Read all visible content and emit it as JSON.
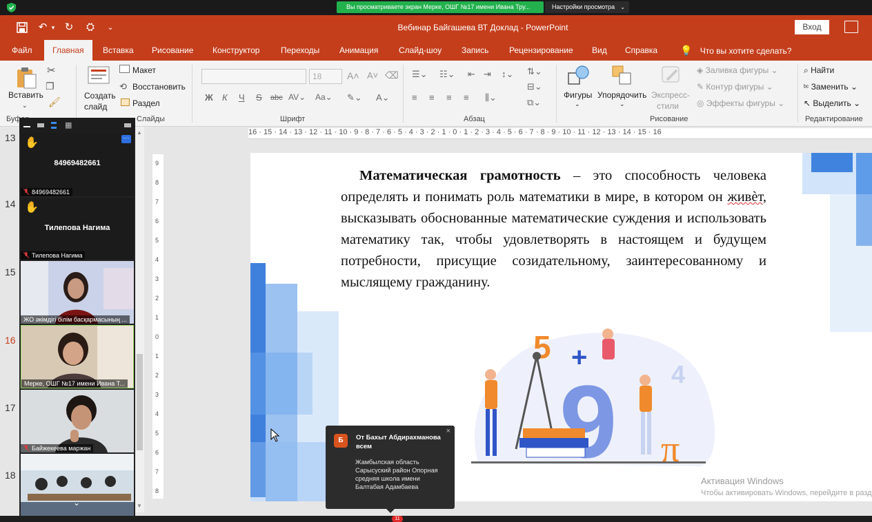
{
  "zoom": {
    "share_banner": "Вы просматриваете экран Мерке, ОШГ №17 имени Ивана Тру...",
    "view_options": "Настройки просмотра"
  },
  "powerpoint": {
    "title": "Вебинар Байгашева ВТ Доклад  -  PowerPoint",
    "signin": "Вход",
    "tabs": [
      "Файл",
      "Главная",
      "Вставка",
      "Рисование",
      "Конструктор",
      "Переходы",
      "Анимация",
      "Слайд-шоу",
      "Запись",
      "Рецензирование",
      "Вид",
      "Справка"
    ],
    "active_tab": "Главная",
    "tell_me": "Что вы хотите сделать?",
    "ribbon": {
      "paste": "Вставить",
      "clipboard_group": "Буфер",
      "new_slide_line1": "Создать",
      "new_slide_line2": "слайд",
      "layout": "Макет",
      "reset": "Восстановить",
      "section": "Раздел",
      "slides_group": "Слайды",
      "font_size": "18",
      "font_group": "Шрифт",
      "paragraph_group": "Абзац",
      "shapes": "Фигуры",
      "arrange": "Упорядочить",
      "quick_styles_line1": "Экспресс-",
      "quick_styles_line2": "стили",
      "shape_fill": "Заливка фигуры",
      "shape_outline": "Контур фигуры",
      "shape_effects": "Эффекты фигуры",
      "drawing_group": "Рисование",
      "find": "Найти",
      "replace": "Заменить",
      "select": "Выделить",
      "editing_group": "Редактирование"
    },
    "slide_numbers": [
      "13",
      "14",
      "15",
      "16",
      "17",
      "18"
    ],
    "ruler_h": "16 · 15 · 14 · 13 · 12 · 11 · 10 · 9 · 8 · 7 · 6 · 5 · 4 · 3 · 2 · 1 · 0 · 1 · 2 · 3 · 4 · 5 · 6 · 7 · 8 · 9 · 10 · 11 · 12 · 13 · 14 · 15 · 16",
    "slide": {
      "bold_term": "Математическая грамотность",
      "text_a": " – это способность человека определять и понимать роль математики в мире, в котором он ",
      "text_squig": "живѐт",
      "text_b": ", высказывать обоснованные математические суждения и использовать математику так, чтобы удовлетворять в настоящем и будущем потребности, присущие созидательному, заинтересованному и мыслящему гражданину."
    },
    "watermark_title": "Активация Windows",
    "watermark_sub": "Чтобы активировать Windows, перейдите в разд"
  },
  "participants": [
    {
      "display": "84969482661",
      "label": "84969482661",
      "video": false
    },
    {
      "display": "Тилепова Нагима",
      "label": "Тилепова Нагима",
      "video": false
    },
    {
      "label": "ЖО әкімдігі білім басқармасының ...",
      "video": true
    },
    {
      "label": "Мерке, ОШГ №17 имени Ивана Т...",
      "video": true
    },
    {
      "label": "Байжекеева маржан",
      "video": true
    },
    {
      "label": "",
      "video": true
    }
  ],
  "chat": {
    "initial": "Б",
    "from": "От Бахыт Абдирахманова всем",
    "message": "Жамбылская область Сарысуский район Опорная средняя школа имени Балтабая Адамбаева",
    "badge": "11"
  }
}
